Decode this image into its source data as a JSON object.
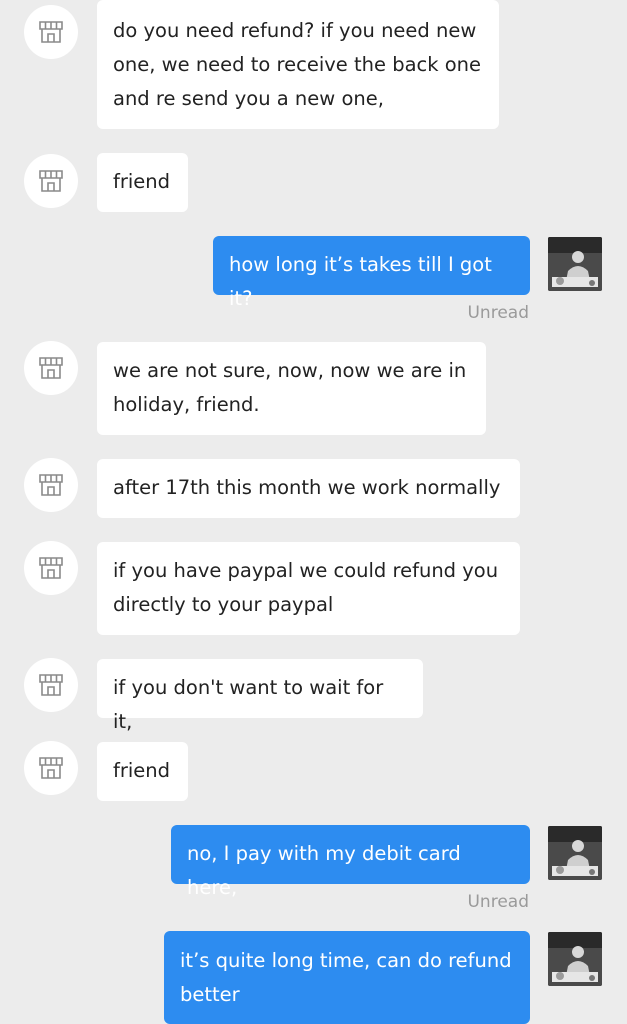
{
  "messages": [
    {
      "side": "in",
      "text": "do you need refund? if you need new\none, we need to receive the back one\nand re send you a new one,"
    },
    {
      "side": "in",
      "text": "friend"
    },
    {
      "side": "out",
      "text": "how long it’s takes till I got it?",
      "status": "Unread"
    },
    {
      "side": "in",
      "text": "we are not sure, now, now we are in\nholiday, friend."
    },
    {
      "side": "in",
      "text": "after 17th this month we work normally"
    },
    {
      "side": "in",
      "text": "if you have paypal we could refund you\ndirectly to your paypal"
    },
    {
      "side": "in",
      "text": "if you don't want to wait for it,"
    },
    {
      "side": "in",
      "text": "friend"
    },
    {
      "side": "out",
      "text": "no, I pay with my debit card here,",
      "status": "Unread"
    },
    {
      "side": "out",
      "text": "it’s quite long time, can do refund\nbetter"
    }
  ],
  "icons": {
    "store_avatar": "store-icon",
    "user_avatar": "user-photo"
  },
  "colors": {
    "background": "#ececec",
    "incoming_bubble": "#ffffff",
    "outgoing_bubble": "#2d8cf0",
    "status_text": "#9a9a9a"
  }
}
